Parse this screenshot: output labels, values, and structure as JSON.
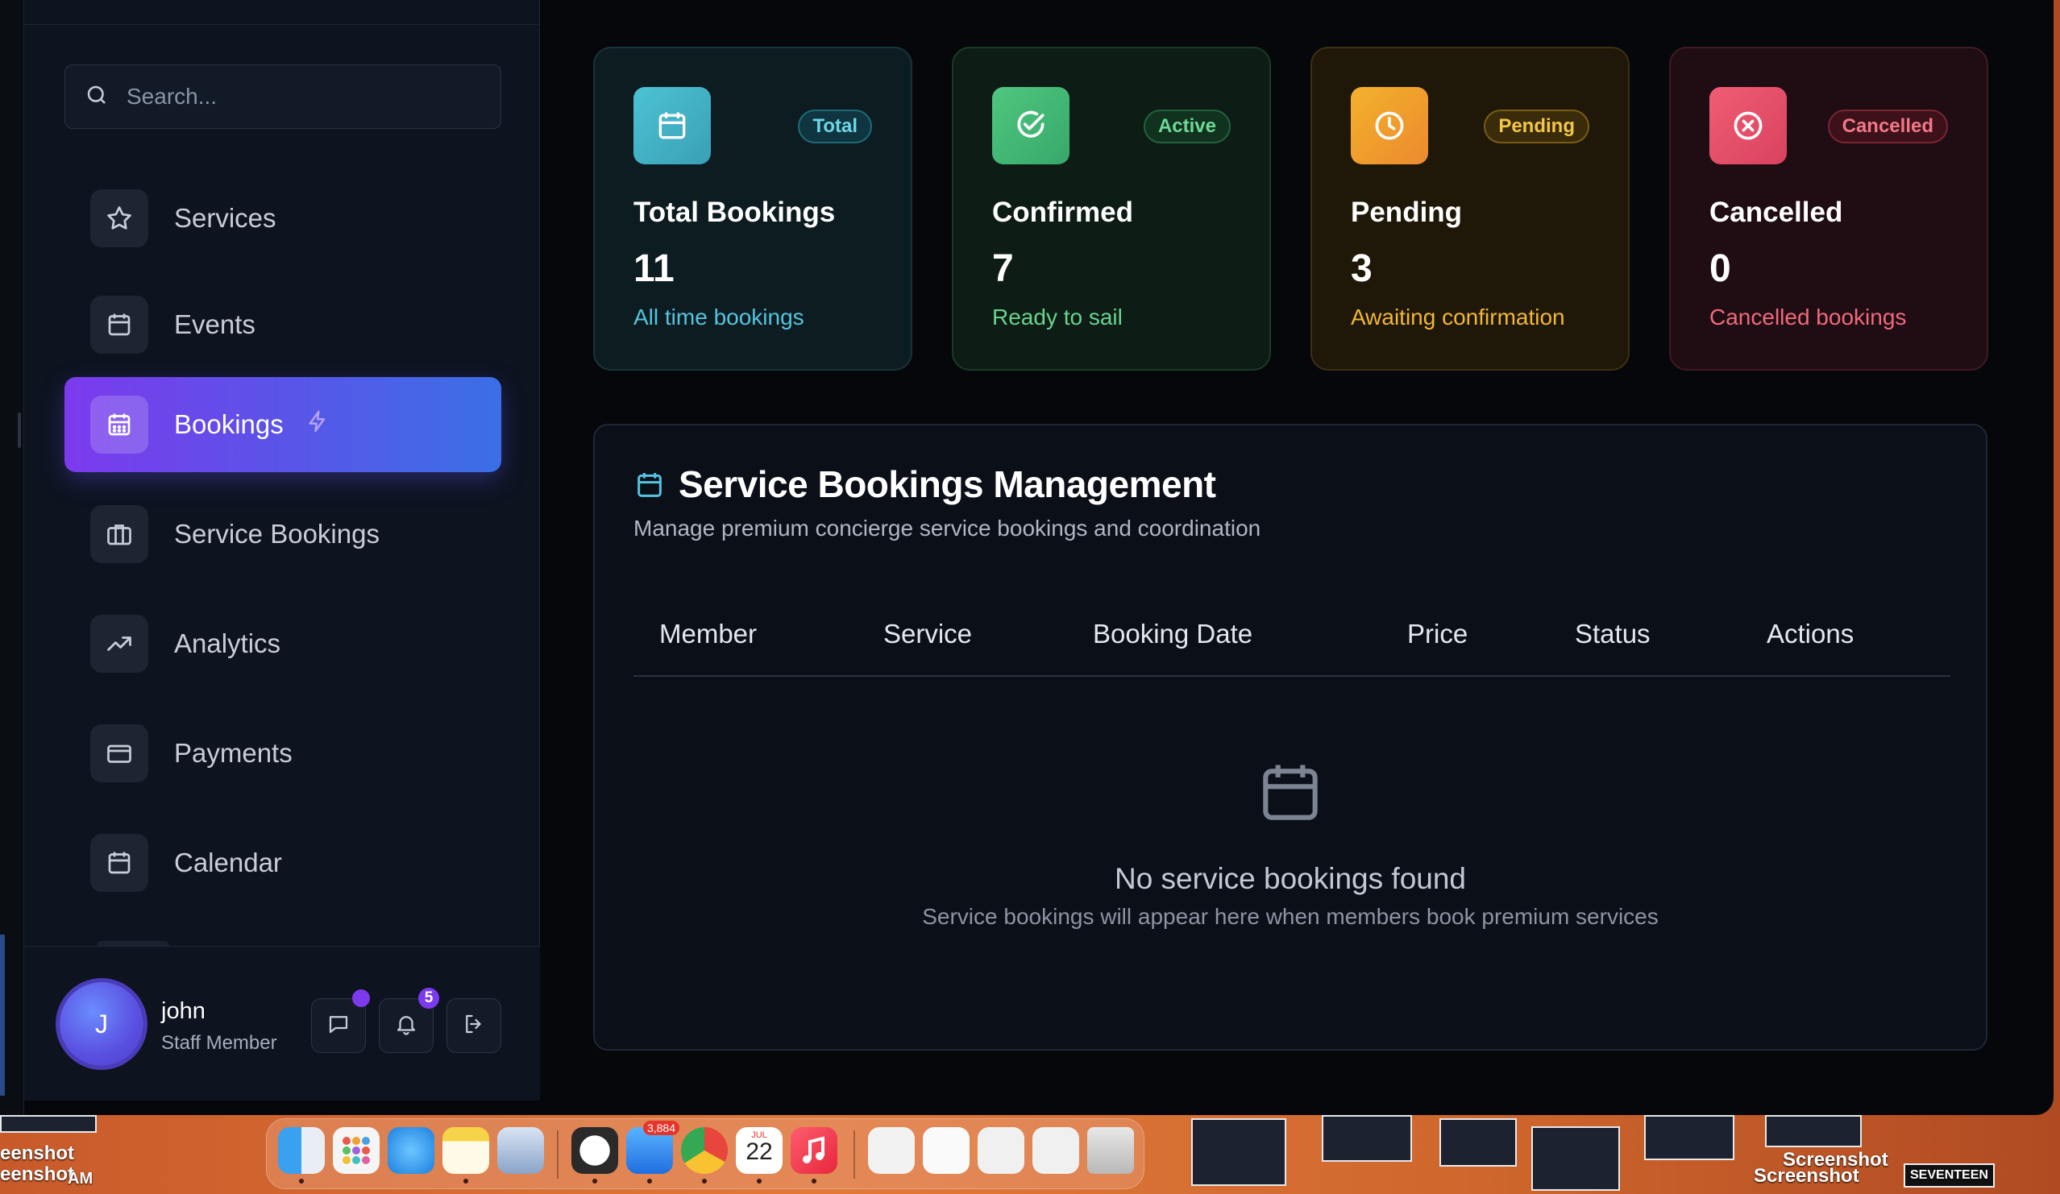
{
  "sidebar": {
    "search_placeholder": "Search...",
    "items": [
      {
        "label": "Services",
        "icon": "star-icon"
      },
      {
        "label": "Events",
        "icon": "calendar-icon"
      },
      {
        "label": "Bookings",
        "icon": "calendar-grid-icon",
        "active": true
      },
      {
        "label": "Service Bookings",
        "icon": "briefcase-icon"
      },
      {
        "label": "Analytics",
        "icon": "trending-up-icon"
      },
      {
        "label": "Payments",
        "icon": "credit-card-icon"
      },
      {
        "label": "Calendar",
        "icon": "calendar-icon"
      }
    ],
    "user": {
      "initial": "J",
      "name": "john",
      "role": "Staff Member",
      "notifications_count": "5"
    }
  },
  "stats": [
    {
      "badge": "Total",
      "title": "Total Bookings",
      "value": "11",
      "subtitle": "All time bookings",
      "accent": "#4fb8d0",
      "icon": "calendar-icon"
    },
    {
      "badge": "Active",
      "title": "Confirmed",
      "value": "7",
      "subtitle": "Ready to sail",
      "accent": "#4ec28a",
      "icon": "check-circle-icon"
    },
    {
      "badge": "Pending",
      "title": "Pending",
      "value": "3",
      "subtitle": "Awaiting confirmation",
      "accent": "#f0b429",
      "icon": "clock-icon"
    },
    {
      "badge": "Cancelled",
      "title": "Cancelled",
      "value": "0",
      "subtitle": "Cancelled bookings",
      "accent": "#e85a6a",
      "icon": "x-circle-icon"
    }
  ],
  "panel": {
    "title": "Service Bookings Management",
    "subtitle": "Manage premium concierge service bookings and coordination",
    "columns": [
      "Member",
      "Service",
      "Booking Date",
      "Price",
      "Status",
      "Actions"
    ],
    "empty_title": "No service bookings found",
    "empty_subtitle": "Service bookings will appear here when members book premium services"
  },
  "dock": {
    "mail_badge": "3,884",
    "calendar_month": "JUL",
    "calendar_day": "22",
    "left_labels": [
      "eenshot",
      "eenshot",
      "AM"
    ],
    "right_labels": [
      "Screenshot",
      "Screenshot",
      "SEVENTEEN"
    ]
  }
}
